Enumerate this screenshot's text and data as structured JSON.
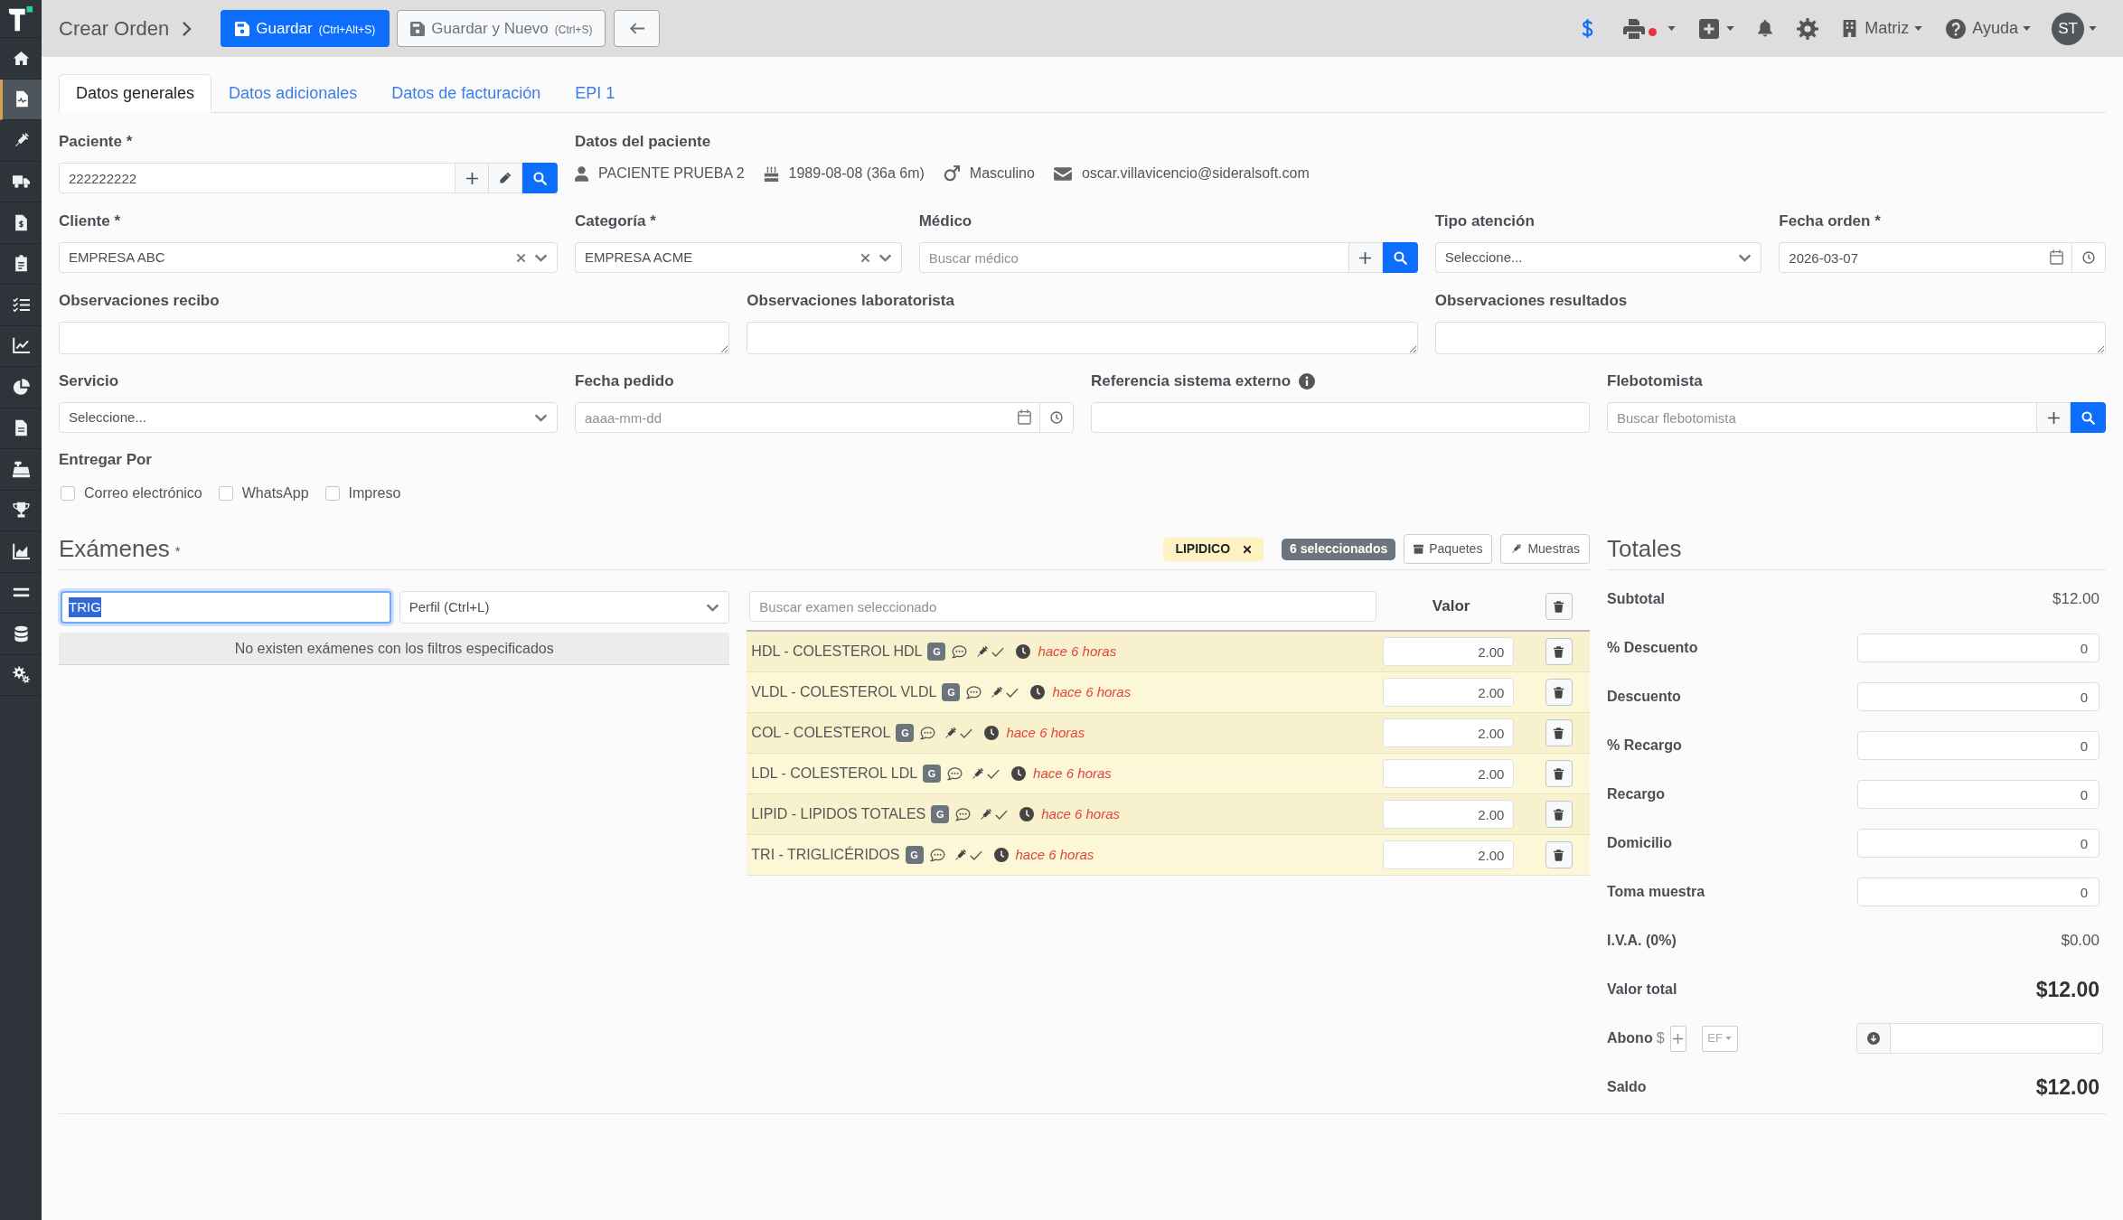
{
  "sidebar": {
    "items": [
      {
        "selected": false
      },
      {
        "selected": true
      },
      {
        "selected": false
      },
      {
        "selected": false
      },
      {
        "selected": false
      },
      {
        "selected": false
      },
      {
        "selected": false
      },
      {
        "selected": false
      },
      {
        "selected": false
      },
      {
        "selected": false
      },
      {
        "selected": false
      },
      {
        "selected": false
      },
      {
        "selected": false
      },
      {
        "selected": false
      },
      {
        "selected": false
      },
      {
        "selected": false
      }
    ]
  },
  "header": {
    "title": "Crear Orden",
    "buttons": [
      {
        "kind": "primary",
        "label": "Guardar",
        "shortcut": "(Ctrl+Alt+S)"
      },
      {
        "kind": "secondary",
        "label": "Guardar y Nuevo",
        "shortcut": "(Ctrl+S)"
      },
      {
        "kind": "back"
      }
    ],
    "printer_notification": true,
    "branch_menu": "Matriz",
    "help_menu": "Ayuda",
    "user_initials": "ST"
  },
  "tabs": [
    {
      "label": "Datos generales",
      "selected": true
    },
    {
      "label": "Datos adicionales",
      "selected": false
    },
    {
      "label": "Datos de facturación",
      "selected": false
    },
    {
      "label": "EPI 1",
      "selected": false
    }
  ],
  "form": {
    "patient": {
      "label": "Paciente *",
      "value": "222222222"
    },
    "patient_details": {
      "label": "Datos del paciente",
      "name": "PACIENTE PRUEBA 2",
      "birth_date": "1989-08-08 (36a 6m)",
      "sex": "Masculino",
      "email": "oscar.villavicencio@sideralsoft.com"
    },
    "client": {
      "label": "Cliente *",
      "value": "EMPRESA ABC"
    },
    "category": {
      "label": "Categoría *",
      "value": "EMPRESA ACME"
    },
    "doctor": {
      "label": "Médico",
      "placeholder": "Buscar médico"
    },
    "care_type": {
      "label": "Tipo atención",
      "value": "Seleccione..."
    },
    "order_date": {
      "label": "Fecha orden *",
      "value": "2026-03-07"
    },
    "receipt_notes": {
      "label": "Observaciones recibo"
    },
    "lab_notes": {
      "label": "Observaciones laboratorista"
    },
    "result_notes": {
      "label": "Observaciones resultados"
    },
    "service": {
      "label": "Servicio",
      "value": "Seleccione..."
    },
    "request_date": {
      "label": "Fecha pedido",
      "placeholder": "aaaa-mm-dd"
    },
    "external_reference": {
      "label": "Referencia sistema externo"
    },
    "phlebotomist": {
      "label": "Flebotomista",
      "placeholder": "Buscar flebotomista"
    },
    "deliver_by": {
      "label": "Entregar Por",
      "options": [
        {
          "label": "Correo electrónico",
          "checked": false
        },
        {
          "label": "WhatsApp",
          "checked": false
        },
        {
          "label": "Impreso",
          "checked": false
        }
      ]
    }
  },
  "exams": {
    "title": "Exámenes",
    "required_mark": "*",
    "profile_tag": "LIPIDICO",
    "selected_count": "6 seleccionados",
    "buttons": [
      {
        "kind": "packages",
        "label": "Paquetes"
      },
      {
        "kind": "samples",
        "label": "Muestras"
      }
    ],
    "filter": {
      "value": "TRIG",
      "focused": true,
      "profile_select": "Perfil (Ctrl+L)"
    },
    "empty_message": "No existen exámenes con los filtros especificados",
    "selected": {
      "search_placeholder": "Buscar examen seleccionado",
      "value_header": "Valor",
      "rows": [
        {
          "name": "HDL - COLESTEROL HDL",
          "badge": "G",
          "time": "hace 6 horas",
          "value": "2.00"
        },
        {
          "name": "VLDL - COLESTEROL VLDL",
          "badge": "G",
          "time": "hace 6 horas",
          "value": "2.00"
        },
        {
          "name": "COL - COLESTEROL",
          "badge": "G",
          "time": "hace 6 horas",
          "value": "2.00"
        },
        {
          "name": "LDL - COLESTEROL LDL",
          "badge": "G",
          "time": "hace 6 horas",
          "value": "2.00"
        },
        {
          "name": "LIPID - LIPIDOS TOTALES",
          "badge": "G",
          "time": "hace 6 horas",
          "value": "2.00"
        },
        {
          "name": "TRI - TRIGLICÉRIDOS",
          "badge": "G",
          "time": "hace 6 horas",
          "value": "2.00"
        }
      ]
    }
  },
  "totals": {
    "title": "Totales",
    "rows": [
      {
        "kind": "amount",
        "label": "Subtotal",
        "value": "$12.00"
      },
      {
        "kind": "input",
        "label": "% Descuento",
        "value": "0"
      },
      {
        "kind": "input",
        "label": "Descuento",
        "value": "0"
      },
      {
        "kind": "input",
        "label": "% Recargo",
        "value": "0"
      },
      {
        "kind": "input",
        "label": "Recargo",
        "value": "0"
      },
      {
        "kind": "input",
        "label": "Domicilio",
        "value": "0"
      },
      {
        "kind": "input",
        "label": "Toma muestra",
        "value": "0"
      },
      {
        "kind": "amount",
        "label": "I.V.A. (0%)",
        "value": "$0.00"
      },
      {
        "kind": "total",
        "label": "Valor total",
        "value": "$12.00"
      },
      {
        "kind": "payment",
        "label": "Abono",
        "currency": "$",
        "method": "EF"
      },
      {
        "kind": "total",
        "label": "Saldo",
        "value": "$12.00"
      }
    ]
  }
}
